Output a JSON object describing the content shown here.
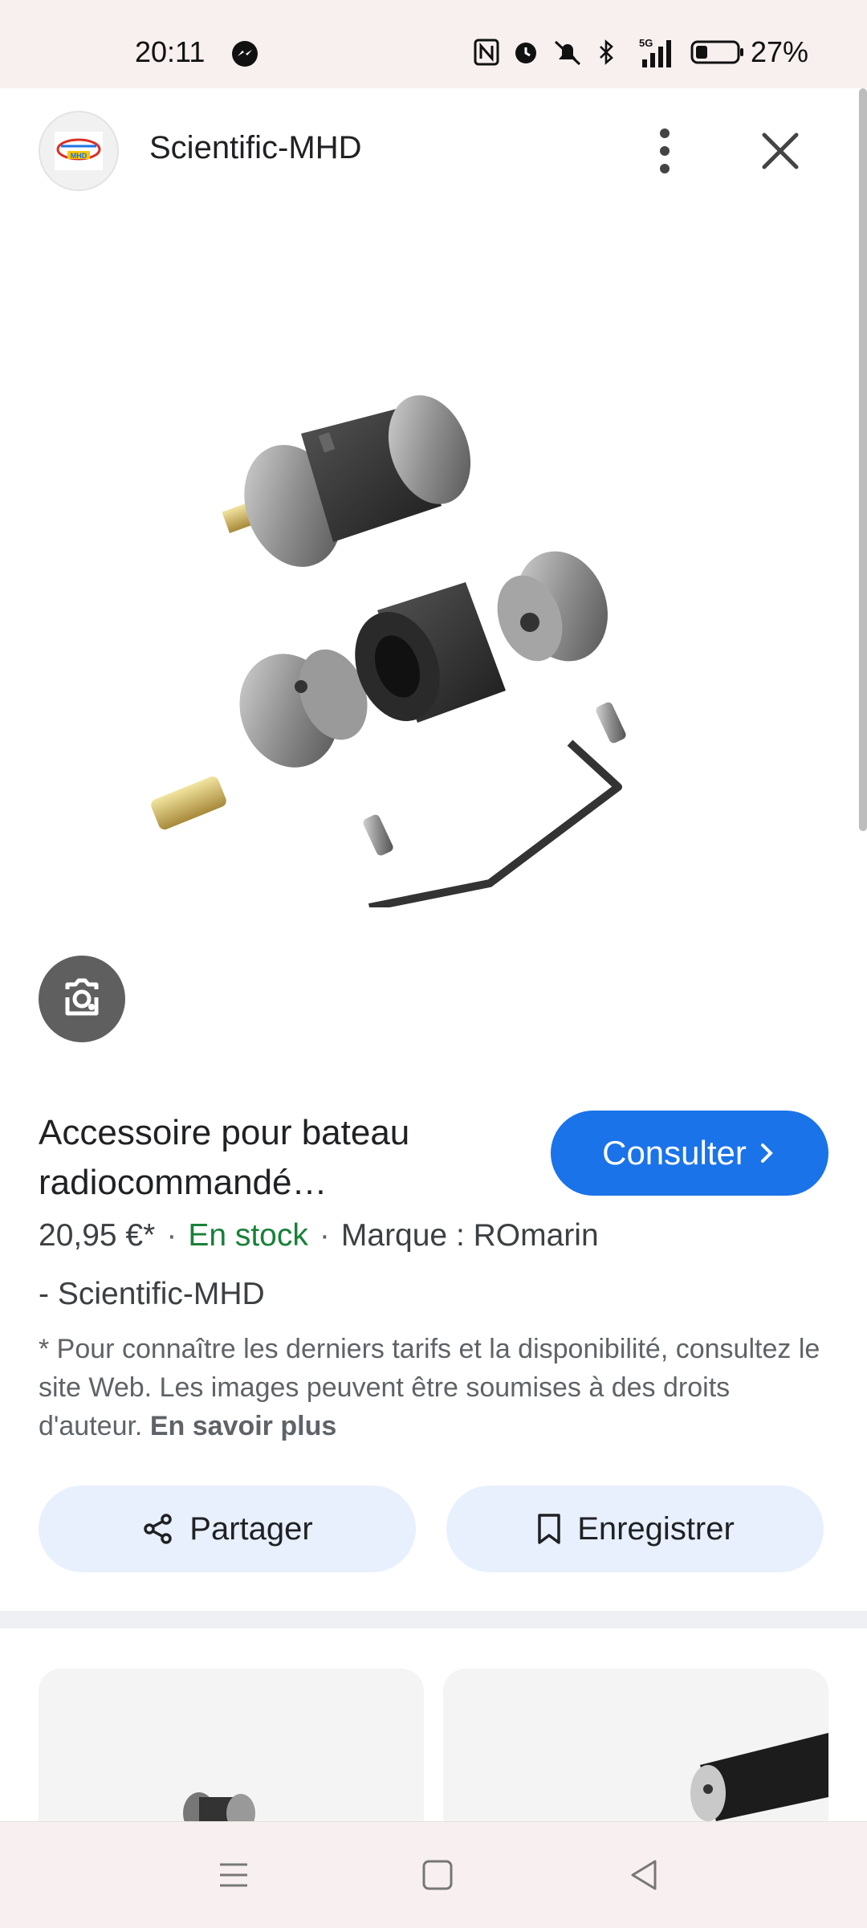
{
  "status_bar": {
    "time": "20:11",
    "battery_percent": "27%",
    "network": "5G",
    "icons": [
      "messenger-icon",
      "nfc-icon",
      "alarm-icon",
      "mute-icon",
      "bluetooth-icon",
      "signal-icon",
      "battery-icon"
    ]
  },
  "header": {
    "site_name": "Scientific-MHD",
    "logo_text": "MHD"
  },
  "product": {
    "title": "Accessoire pour bateau radiocommandé…",
    "price": "20,95 €*",
    "stock": "En stock",
    "brand": "Marque : ROmarin",
    "seller": "- Scientific-MHD",
    "disclaimer": "* Pour connaître les derniers tarifs et la disponibilité, consultez le site Web. Les images peuvent être soumises à des droits d'auteur.",
    "learn_more": "En savoir plus"
  },
  "buttons": {
    "consult": "Consulter",
    "share": "Partager",
    "save": "Enregistrer"
  },
  "colors": {
    "primary": "#1a73e8",
    "stock_green": "#188038",
    "chip_bg": "#e8f0fe"
  }
}
